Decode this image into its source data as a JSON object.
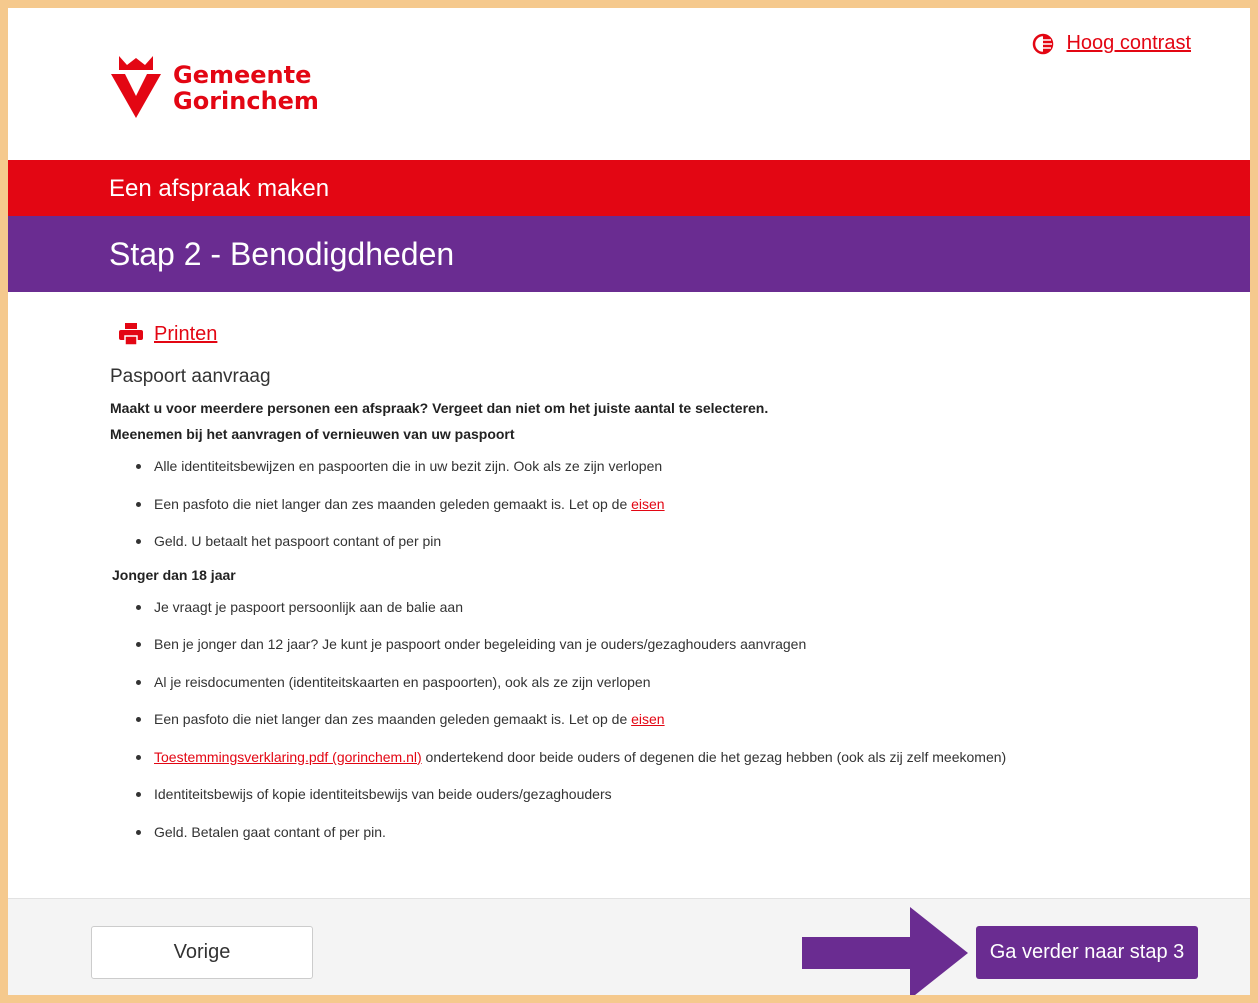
{
  "header": {
    "logo_line1": "Gemeente",
    "logo_line2": "Gorinchem",
    "contrast_label": "Hoog contrast"
  },
  "banner": {
    "title": "Een afspraak maken",
    "step": "Stap 2 - Benodigdheden"
  },
  "content": {
    "print_label": "Printen",
    "section_title": "Paspoort aanvraag",
    "notice": "Maakt u voor meerdere personen een afspraak? Vergeet dan niet om het juiste aantal te selecteren.",
    "intro": "Meenemen bij het aanvragen of vernieuwen van uw paspoort",
    "list1": [
      "Alle identiteitsbewijzen en paspoorten die in uw bezit zijn. Ook als ze zijn verlopen",
      "Een pasfoto die niet langer dan zes maanden geleden gemaakt is. Let op de ",
      "Geld. U betaalt het paspoort contant of per pin"
    ],
    "eisen_link": "eisen",
    "under18_title": "Jonger dan 18 jaar",
    "list2": [
      "Je vraagt je paspoort persoonlijk aan de balie aan",
      "Ben je jonger dan 12 jaar? Je kunt je paspoort onder begeleiding van je ouders/gezaghouders aanvragen",
      "Al je reisdocumenten (identiteitskaarten en paspoorten), ook als ze zijn verlopen",
      "Een pasfoto die niet langer dan zes maanden geleden gemaakt is. Let op de ",
      " ondertekend door beide ouders of degenen die het gezag hebben (ook als zij zelf meekomen)",
      "Identiteitsbewijs of kopie identiteitsbewijs van beide ouders/gezaghouders",
      "Geld. Betalen gaat contant of per pin."
    ],
    "consent_link": "Toestemmingsverklaring.pdf (gorinchem.nl)"
  },
  "footer": {
    "prev_label": "Vorige",
    "next_label": "Ga verder naar stap 3"
  },
  "icons": [
    "crown-logo-icon",
    "contrast-icon",
    "printer-icon",
    "arrow-right-icon"
  ],
  "colors": {
    "brand_red": "#e30613",
    "brand_purple": "#6a2c91",
    "outer_border": "#f5c98d"
  }
}
